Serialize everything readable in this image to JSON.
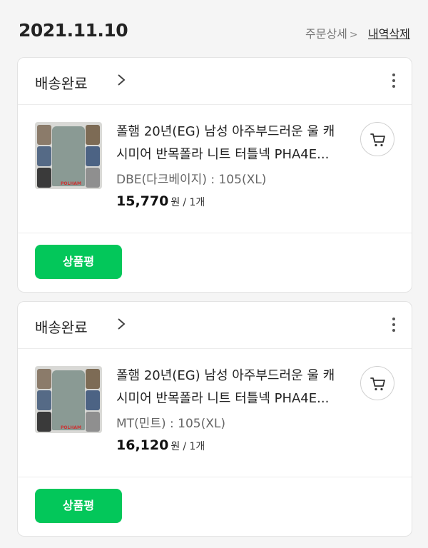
{
  "header": {
    "date": "2021.11.10",
    "order_detail_label": "주문상세",
    "order_detail_chevron": ">",
    "delete_history_label": "내역삭제"
  },
  "orders": [
    {
      "status": "배송완료",
      "product_title": "폴햄 20년(EG) 남성 아주부드러운 울 캐시미어 반목폴라 니트 터틀넥 PHA4E...",
      "option": "DBE(다크베이지) : 105(XL)",
      "price": "15,770",
      "price_unit": "원",
      "quantity": "/ 1개",
      "thumbnail_logo": "POLHAM",
      "review_button_label": "상품평"
    },
    {
      "status": "배송완료",
      "product_title": "폴햄 20년(EG) 남성 아주부드러운 울 캐시미어 반목폴라 니트 터틀넥 PHA4E...",
      "option": "MT(민트) : 105(XL)",
      "price": "16,120",
      "price_unit": "원",
      "quantity": "/ 1개",
      "thumbnail_logo": "POLHAM",
      "review_button_label": "상품평"
    }
  ],
  "icons": {
    "status_chevron": "chevron-right-icon",
    "more": "kebab-menu-icon",
    "cart": "cart-icon"
  },
  "colors": {
    "accent_green": "#03c75a",
    "background": "#f5f5f5",
    "card": "#ffffff"
  }
}
